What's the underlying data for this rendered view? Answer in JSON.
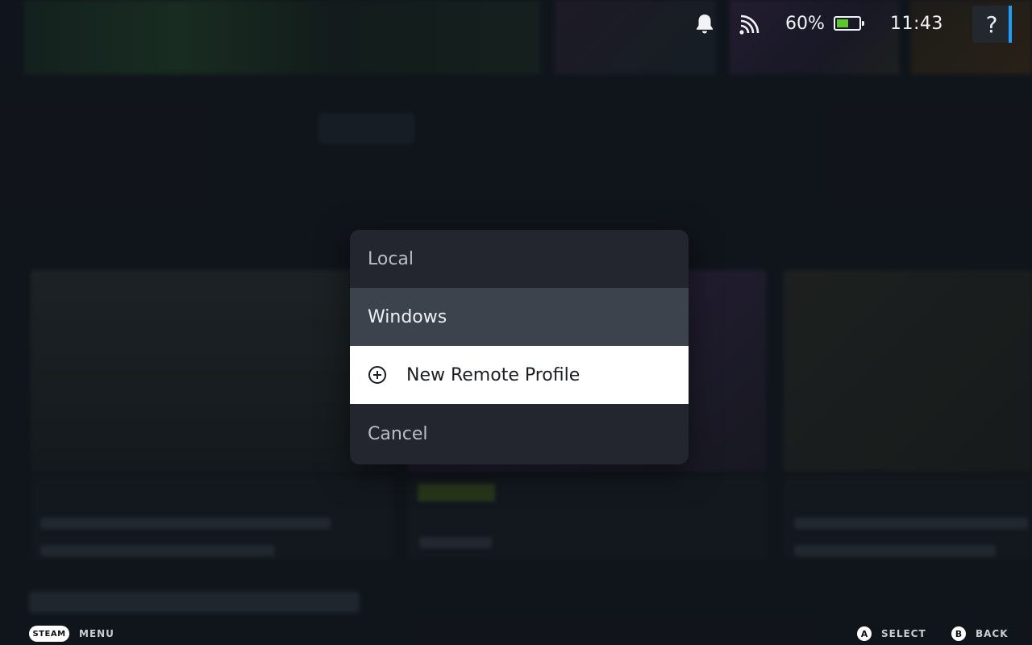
{
  "status_bar": {
    "battery_percent": "60%",
    "battery_level": 0.6,
    "clock": "11:43",
    "help_glyph": "?",
    "icons": [
      "bell-icon",
      "broadcast-icon",
      "battery-icon"
    ]
  },
  "menu": {
    "items": [
      {
        "label": "Local"
      },
      {
        "label": "Windows"
      },
      {
        "label": "New Remote Profile",
        "icon": "plus-circle-icon"
      },
      {
        "label": "Cancel"
      }
    ]
  },
  "footer": {
    "steam_label": "STEAM",
    "menu_label": "MENU",
    "a_glyph": "A",
    "select_label": "SELECT",
    "b_glyph": "B",
    "back_label": "BACK"
  },
  "colors": {
    "accent": "#1a9fff",
    "battery_fill": "#5cc530",
    "highlight": "#ffffff",
    "focus": "#3d434d"
  }
}
